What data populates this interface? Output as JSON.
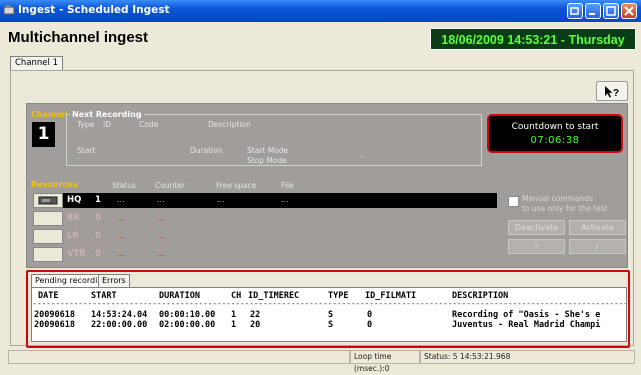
{
  "window": {
    "title": "Ingest - Scheduled Ingest"
  },
  "header": {
    "app_title": "Multichannel ingest",
    "clock": "18/06/2009 14:53:21 - Thursday"
  },
  "tabs": {
    "channel1": "Channel 1"
  },
  "help_button": {
    "label": "↘?"
  },
  "channel": {
    "label": "Channel",
    "number": "1"
  },
  "next_recording": {
    "label": "Next Recording",
    "type_label": "Type",
    "id_label": "ID",
    "code_label": "Code",
    "description_label": "Description",
    "start_label": "Start",
    "duration_label": "Duration",
    "start_mode_label": "Start Mode",
    "stop_mode_label": "Stop Mode",
    "dash": "-"
  },
  "countdown": {
    "label": "Countdown to start",
    "value": "07:06:38"
  },
  "resources": {
    "label": "Resources",
    "headers": {
      "status": "Status",
      "counter": "Counter",
      "free_space": "Free space",
      "file": "File"
    },
    "rows": [
      {
        "name": "HQ",
        "num": "1",
        "status": "...",
        "counter": "...",
        "free_space": "...",
        "file": "..."
      },
      {
        "name": "BK",
        "num": "0",
        "status": "...",
        "counter": "..."
      },
      {
        "name": "LR",
        "num": "0",
        "status": "...",
        "counter": "..."
      },
      {
        "name": "VTR",
        "num": "0",
        "status": "...",
        "counter": "..."
      }
    ]
  },
  "manual": {
    "line1": "Manual commands",
    "line2": "to use only for the test",
    "deactivate": "Deactivate",
    "activate": "Activate",
    "rec": "r",
    "stop": "r"
  },
  "bottom_tabs": {
    "pending": "Pending recordings",
    "errors": "Errors"
  },
  "pending_table": {
    "headers": {
      "date": "DATE",
      "start": "START",
      "duration": "DURATION",
      "ch": "CH",
      "id_timerec": "ID_TIMEREC",
      "type": "TYPE",
      "id_filmati": "ID_FILMATI",
      "description": "DESCRIPTION"
    },
    "separator": "----------------------------------------------------------------------------------------------------------------------------------",
    "rows": [
      {
        "date": "20090618",
        "start": "14:53:24.04",
        "duration": "00:00:10.00",
        "ch": "1",
        "id_timerec": "22",
        "type": "S",
        "id_filmati": "0",
        "description": "Recording of \"Oasis - She's e"
      },
      {
        "date": "20090618",
        "start": "22:00:00.00",
        "duration": "02:00:00.00",
        "ch": "1",
        "id_timerec": "20",
        "type": "S",
        "id_filmati": "0",
        "description": "Juventus - Real Madrid Champi"
      }
    ]
  },
  "status_bar": {
    "loop_time": "Loop time (msec.):0",
    "status": "Status: 5  14:53:21.968"
  }
}
